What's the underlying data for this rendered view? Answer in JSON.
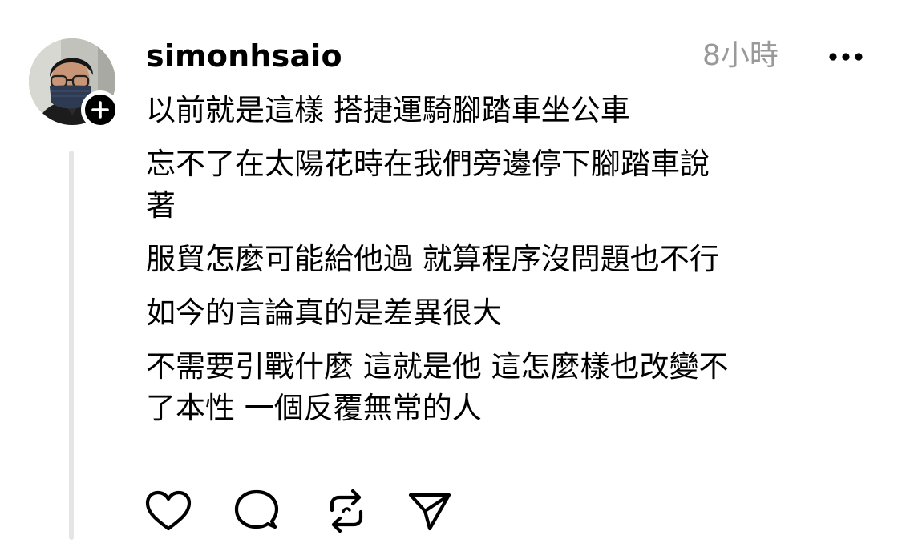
{
  "post": {
    "username": "simonhsaio",
    "timestamp": "8小時",
    "lines": [
      "以前就是這樣 搭捷運騎腳踏車坐公車",
      "忘不了在太陽花時在我們旁邊停下腳踏車說",
      "著",
      "服貿怎麼可能給他過 就算程序沒問題也不行",
      "如今的言論真的是差異很大",
      "不需要引戰什麼 這就是他 這怎麼樣也改變不",
      "了本性 一個反覆無常的人"
    ]
  },
  "icons": {
    "avatar": "user-avatar",
    "follow": "plus-icon",
    "more": "more-horizontal-icon",
    "like": "heart-icon",
    "comment": "comment-bubble-icon",
    "repost": "repost-icon",
    "share": "send-icon"
  },
  "colors": {
    "text": "#000000",
    "timestamp": "#999999",
    "thread_line": "#e5e5e5"
  }
}
